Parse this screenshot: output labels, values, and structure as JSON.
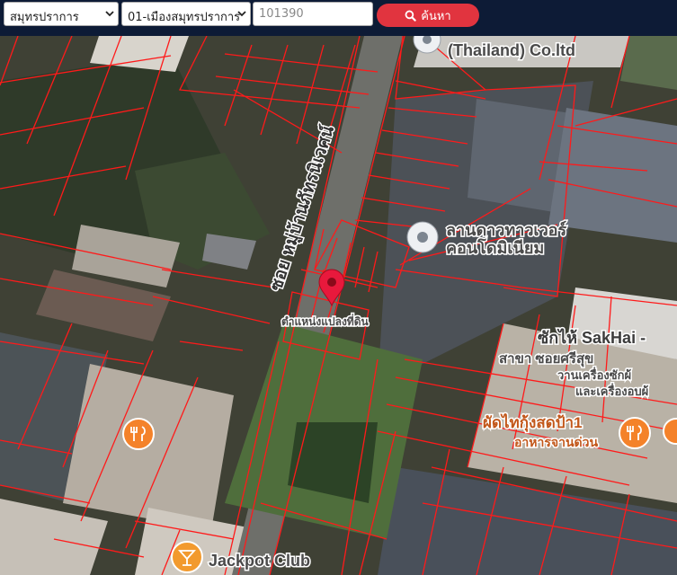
{
  "search": {
    "province": "สมุทรปราการ",
    "district": "01-เมืองสมุทรปราการ",
    "parcel_no": "101390",
    "button_label": "ค้นหา"
  },
  "map": {
    "labels": {
      "company": "(Thailand) Co.ltd",
      "road": "ซอย หมู่บ้านภัทรนิเวศน์",
      "condo_line1": "ลานดาวทาวเวอร์",
      "condo_line2": "คอนโดมิเนียม",
      "parcel_marker": "ตำแหน่งแปลงที่ดิน",
      "sakhai": "ซักไห้ SakHai -",
      "branch_line1": "สาขา ซอยศรีสุข",
      "branch_line2": "วานเครื่องซักผ้",
      "branch_line3": "และเครื่องอบผ้",
      "padthai_line1": "ผัดไทกุ้งสดป้า1",
      "padthai_line2": "อาหารจานด่วน",
      "jackpot": "Jackpot Club"
    },
    "colors": {
      "parcel_line": "#ff1a1a",
      "marker": "#e8193c",
      "restaurant_pin": "#f4822a",
      "bar_pin": "#f29a2e"
    }
  }
}
